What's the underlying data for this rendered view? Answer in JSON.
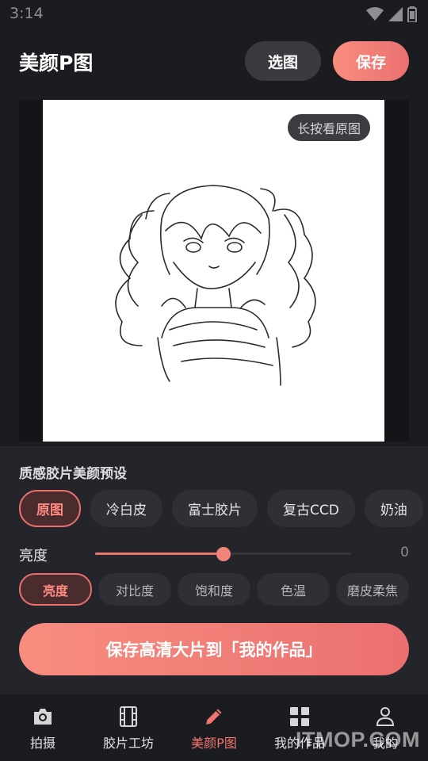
{
  "status_bar": {
    "time": "3:14"
  },
  "header": {
    "title": "美颜P图",
    "pick_label": "选图",
    "save_label": "保存"
  },
  "preview": {
    "hint": "长按看原图"
  },
  "panel": {
    "presets_title": "质感胶片美颜预设",
    "presets": [
      "原图",
      "冷白皮",
      "富士胶片",
      "复古CCD",
      "奶油"
    ],
    "active_preset": "原图",
    "adjust_label": "亮度",
    "adjust_value": "0",
    "slider_fraction": 0.5,
    "tools": [
      "亮度",
      "对比度",
      "饱和度",
      "色温",
      "磨皮柔焦"
    ],
    "active_tool": "亮度",
    "save_hd_label": "保存高清大片到「我的作品」"
  },
  "bottom_nav": {
    "items": [
      {
        "label": "拍摄",
        "icon": "camera-icon"
      },
      {
        "label": "胶片工坊",
        "icon": "film-icon"
      },
      {
        "label": "美颜P图",
        "icon": "pencil-icon"
      },
      {
        "label": "我的作品",
        "icon": "grid-icon"
      },
      {
        "label": "我的",
        "icon": "person-icon"
      }
    ],
    "active": "美颜P图"
  },
  "watermark": "ITMOP.COM",
  "colors": {
    "accent": "#ea7470",
    "background": "#1b1c20",
    "panel": "#23252a"
  }
}
